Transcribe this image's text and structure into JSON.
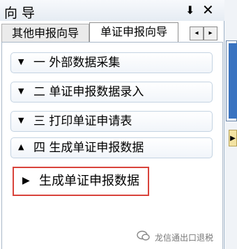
{
  "panel": {
    "title": "向 导",
    "pin_glyph": "⬇",
    "close_glyph": "✕"
  },
  "tabs": [
    {
      "label": "其他申报向导"
    },
    {
      "label": "单证申报向导"
    }
  ],
  "tab_nav": {
    "left": "◂",
    "right": "▸"
  },
  "sections": [
    {
      "arrow": "▼",
      "label": "一  外部数据采集"
    },
    {
      "arrow": "▼",
      "label": "二  单证申报数据录入"
    },
    {
      "arrow": "▼",
      "label": "三  打印单证申请表"
    },
    {
      "arrow": "▲",
      "label": "四  生成单证申报数据"
    }
  ],
  "highlighted_item": {
    "arrow": "▶",
    "label": "生成单证申报数据"
  },
  "right_strip": {
    "marker": "▶"
  },
  "watermark": "龙信通出口退税"
}
